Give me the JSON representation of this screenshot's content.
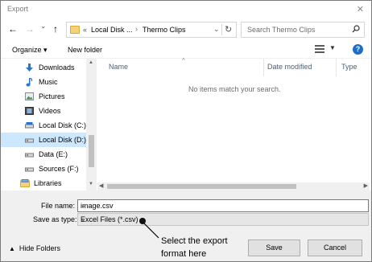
{
  "window": {
    "title": "Export",
    "close_glyph": "✕"
  },
  "nav": {
    "back_glyph": "←",
    "forward_glyph": "→",
    "recent_glyph": "⌄",
    "up_glyph": "↑"
  },
  "address": {
    "overflow": "«",
    "crumbs": [
      "Local Disk ...",
      "Thermo Clips"
    ],
    "sep": "›",
    "dropdown_glyph": "⌄",
    "refresh_glyph": "↻"
  },
  "search": {
    "placeholder": "Search Thermo Clips",
    "icon": "search-icon"
  },
  "toolbar": {
    "organize_label": "Organize ▾",
    "new_folder_label": "New folder",
    "help_glyph": "?"
  },
  "sidebar": {
    "items": [
      {
        "label": "Downloads",
        "icon": "downloads-icon"
      },
      {
        "label": "Music",
        "icon": "music-icon"
      },
      {
        "label": "Pictures",
        "icon": "pictures-icon"
      },
      {
        "label": "Videos",
        "icon": "videos-icon"
      },
      {
        "label": "Local Disk (C:)",
        "icon": "drive-icon"
      },
      {
        "label": "Local Disk (D:)",
        "icon": "drive-icon",
        "selected": true
      },
      {
        "label": "Data (E:)",
        "icon": "drive-icon"
      },
      {
        "label": "Sources (F:)",
        "icon": "drive-icon"
      },
      {
        "label": "Libraries",
        "icon": "libraries-icon"
      }
    ]
  },
  "filelist": {
    "columns": [
      "Name",
      "Date modified",
      "Type"
    ],
    "empty_message": "No items match your search."
  },
  "form": {
    "file_name_label": "File name:",
    "file_name_value": "image.csv",
    "save_as_type_label": "Save as type:",
    "save_as_type_value": "Excel Files (*.csv)"
  },
  "callout": {
    "line1": "Select the export",
    "line2": "format here"
  },
  "footer": {
    "hide_folders_label": "Hide Folders",
    "save_label": "Save",
    "cancel_label": "Cancel"
  },
  "colors": {
    "selection": "#cce8ff",
    "help_blue": "#1c6ec6",
    "folder_yellow": "#f6d277"
  }
}
